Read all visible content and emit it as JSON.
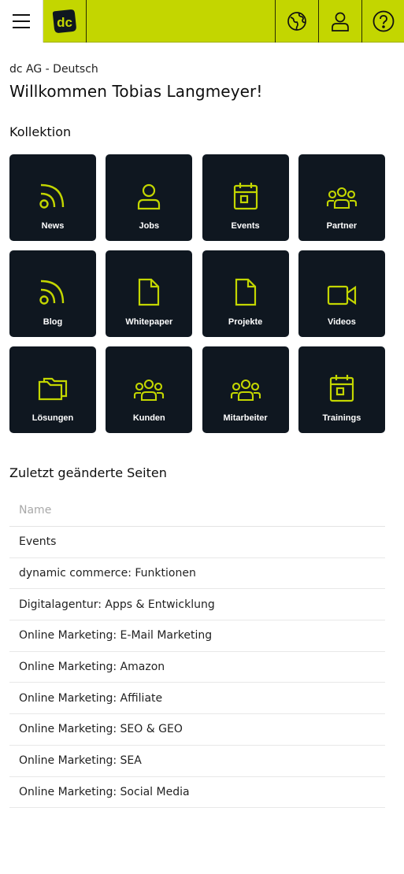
{
  "header": {
    "menu_icon": "hamburger-menu-icon",
    "logo_text": "dc",
    "actions": [
      {
        "icon": "globe-icon"
      },
      {
        "icon": "user-icon"
      },
      {
        "icon": "help-icon"
      }
    ],
    "accent_color": "#c3d600"
  },
  "org": "dc AG - Deutsch",
  "welcome": "Willkommen Tobias Langmeyer!",
  "collection": {
    "title": "Kollektion",
    "tile_color": "#0f1720",
    "icon_color": "#c3d600",
    "tiles": [
      {
        "label": "News",
        "icon": "rss-icon"
      },
      {
        "label": "Jobs",
        "icon": "person-icon"
      },
      {
        "label": "Events",
        "icon": "calendar-icon"
      },
      {
        "label": "Partner",
        "icon": "group-icon"
      },
      {
        "label": "Blog",
        "icon": "rss-icon"
      },
      {
        "label": "Whitepaper",
        "icon": "document-icon"
      },
      {
        "label": "Projekte",
        "icon": "document-icon"
      },
      {
        "label": "Videos",
        "icon": "video-camera-icon"
      },
      {
        "label": "Lösungen",
        "icon": "folder-icon"
      },
      {
        "label": "Kunden",
        "icon": "group-icon"
      },
      {
        "label": "Mitarbeiter",
        "icon": "group-icon"
      },
      {
        "label": "Trainings",
        "icon": "calendar-icon"
      }
    ]
  },
  "recent": {
    "title": "Zuletzt geänderte Seiten",
    "column_header": "Name",
    "rows": [
      "Events",
      "dynamic commerce: Funktionen",
      "Digitalagentur: Apps & Entwicklung",
      "Online Marketing: E-Mail Marketing",
      "Online Marketing: Amazon",
      "Online Marketing: Affiliate",
      "Online Marketing: SEO & GEO",
      "Online Marketing: SEA",
      "Online Marketing: Social Media"
    ]
  }
}
